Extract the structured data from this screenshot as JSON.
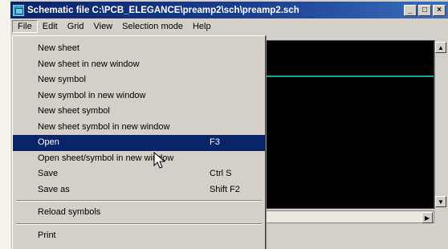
{
  "window": {
    "title": "Schematic file C:\\PCB_ELEGANCE\\preamp2\\sch\\preamp2.sch",
    "controls": {
      "minimize": "_",
      "maximize": "□",
      "close": "×"
    }
  },
  "menubar": {
    "items": [
      "File",
      "Edit",
      "Grid",
      "View",
      "Selection mode",
      "Help"
    ]
  },
  "file_menu": {
    "items": [
      {
        "label": "New sheet",
        "shortcut": ""
      },
      {
        "label": "New sheet in new window",
        "shortcut": ""
      },
      {
        "label": "New symbol",
        "shortcut": ""
      },
      {
        "label": "New symbol in new window",
        "shortcut": ""
      },
      {
        "label": "New sheet symbol",
        "shortcut": ""
      },
      {
        "label": "New sheet symbol in new window",
        "shortcut": ""
      },
      {
        "label": "Open",
        "shortcut": "F3"
      },
      {
        "label": "Open sheet/symbol in new window",
        "shortcut": ""
      },
      {
        "label": "Save",
        "shortcut": "Ctrl S"
      },
      {
        "label": "Save as",
        "shortcut": "Shift F2"
      },
      {
        "label": "Reload symbols",
        "shortcut": ""
      },
      {
        "label": "Print",
        "shortcut": ""
      }
    ],
    "highlighted": "Open"
  },
  "scrollbar": {
    "up": "▲",
    "down": "▼",
    "right": "▶"
  },
  "colors": {
    "titlebar": "#0a246a",
    "highlight": "#0a246a",
    "canvas": "#000000",
    "wire": "#1aa89a"
  },
  "icons": {
    "app": "schematic-app-icon",
    "pointer": "arrow-cursor-icon"
  }
}
